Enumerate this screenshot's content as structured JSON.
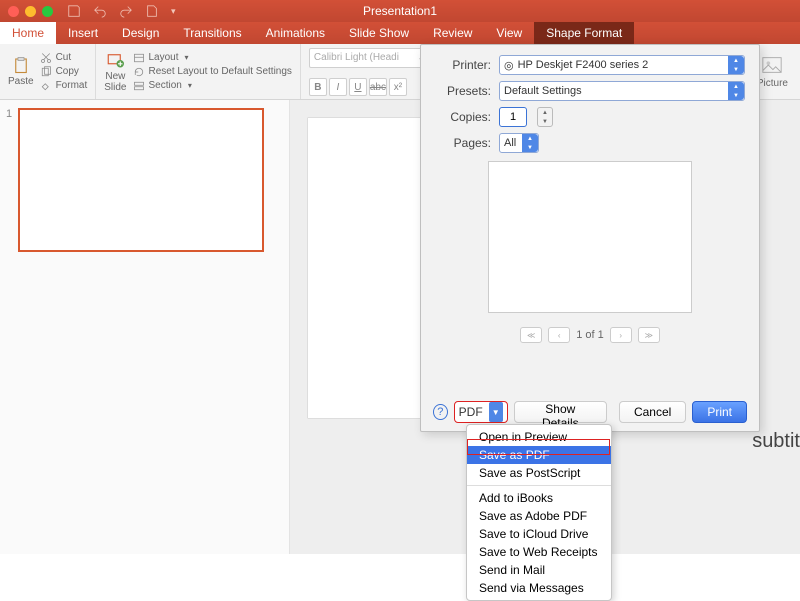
{
  "title": "Presentation1",
  "tabs": {
    "home": "Home",
    "insert": "Insert",
    "design": "Design",
    "transitions": "Transitions",
    "animations": "Animations",
    "slideshow": "Slide Show",
    "review": "Review",
    "view": "View",
    "shapeformat": "Shape Format"
  },
  "ribbon": {
    "paste": "Paste",
    "cut": "Cut",
    "copy": "Copy",
    "format": "Format",
    "new_slide": "New\nSlide",
    "layout": "Layout",
    "reset": "Reset Layout to Default Settings",
    "section": "Section",
    "font_name": "Calibri Light (Headi",
    "picture": "Picture"
  },
  "thumb_num": "1",
  "subtitle_peek": "subtit",
  "print": {
    "label_printer": "Printer:",
    "label_presets": "Presets:",
    "label_copies": "Copies:",
    "label_pages": "Pages:",
    "printer_value": "HP Deskjet F2400 series 2",
    "presets_value": "Default Settings",
    "copies_value": "1",
    "pages_value": "All",
    "page_indicator": "1 of 1",
    "pdf": "PDF",
    "show_details": "Show Details",
    "cancel": "Cancel",
    "print_btn": "Print",
    "help": "?"
  },
  "pdf_menu": {
    "open_preview": "Open in Preview",
    "save_pdf": "Save as PDF",
    "save_ps": "Save as PostScript",
    "ibooks": "Add to iBooks",
    "adobe": "Save as Adobe PDF",
    "icloud": "Save to iCloud Drive",
    "web": "Save to Web Receipts",
    "mail": "Send in Mail",
    "messages": "Send via Messages"
  }
}
